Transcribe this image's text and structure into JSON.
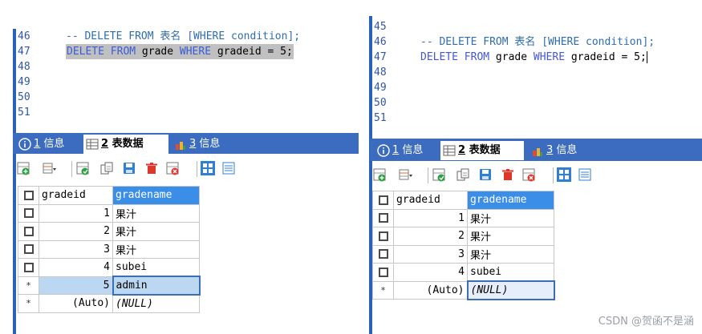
{
  "left": {
    "lines": [
      {
        "no": "46",
        "parts": [
          {
            "t": "-- DELETE FROM 表名 [WHERE condition];",
            "c": "cm"
          }
        ]
      },
      {
        "no": "47",
        "highlight": true,
        "parts": [
          {
            "t": "DELETE",
            "c": "kw"
          },
          {
            "t": " ",
            "c": "tx"
          },
          {
            "t": "FROM",
            "c": "kw"
          },
          {
            "t": " grade ",
            "c": "tx"
          },
          {
            "t": "WHERE",
            "c": "kw"
          },
          {
            "t": " gradeid = 5;",
            "c": "tx"
          }
        ]
      },
      {
        "no": "48",
        "parts": []
      },
      {
        "no": "49",
        "parts": []
      },
      {
        "no": "50",
        "parts": []
      },
      {
        "no": "51",
        "parts": []
      }
    ],
    "tabs": [
      {
        "num": "1",
        "label": "信息"
      },
      {
        "num": "2",
        "label": "表数据"
      },
      {
        "num": "3",
        "label": "信息"
      }
    ],
    "columns": [
      "gradeid",
      "gradename"
    ],
    "rows": [
      {
        "marker": "box",
        "id": "1",
        "name": "果汁"
      },
      {
        "marker": "box",
        "id": "2",
        "name": "果汁"
      },
      {
        "marker": "box",
        "id": "3",
        "name": "果汁"
      },
      {
        "marker": "box",
        "id": "4",
        "name": "subei"
      },
      {
        "marker": "*",
        "id": "5",
        "name": "admin",
        "selected": true
      },
      {
        "marker": "*",
        "id": "(Auto)",
        "name": "(NULL)"
      }
    ]
  },
  "right": {
    "lines": [
      {
        "no": "45",
        "parts": []
      },
      {
        "no": "46",
        "parts": [
          {
            "t": "-- DELETE FROM 表名 [WHERE condition];",
            "c": "cm"
          }
        ]
      },
      {
        "no": "47",
        "cursor": true,
        "parts": [
          {
            "t": "DELETE",
            "c": "kw2"
          },
          {
            "t": " ",
            "c": "tx"
          },
          {
            "t": "FROM",
            "c": "kw2"
          },
          {
            "t": " grade ",
            "c": "tx"
          },
          {
            "t": "WHERE",
            "c": "kw2"
          },
          {
            "t": " gradeid = 5;",
            "c": "tx"
          }
        ]
      },
      {
        "no": "48",
        "parts": []
      },
      {
        "no": "49",
        "parts": []
      },
      {
        "no": "50",
        "parts": []
      },
      {
        "no": "51",
        "parts": []
      }
    ],
    "tabs": [
      {
        "num": "1",
        "label": "信息"
      },
      {
        "num": "2",
        "label": "表数据"
      },
      {
        "num": "3",
        "label": "信息"
      }
    ],
    "columns": [
      "gradeid",
      "gradename"
    ],
    "rows": [
      {
        "marker": "box",
        "id": "1",
        "name": "果汁"
      },
      {
        "marker": "box",
        "id": "2",
        "name": "果汁"
      },
      {
        "marker": "box",
        "id": "3",
        "name": "果汁"
      },
      {
        "marker": "box",
        "id": "4",
        "name": "subei"
      },
      {
        "marker": "*",
        "id": "(Auto)",
        "name": "(NULL)",
        "focused": true
      }
    ]
  },
  "toolbar_icons": [
    "add-row-icon",
    "dropdown-grid-icon",
    "duplicate-row-icon",
    "copy-icon",
    "save-icon",
    "delete-icon",
    "cancel-icon",
    "grid-view-icon",
    "form-view-icon"
  ],
  "watermark": "CSDN @贺函不是涵",
  "colors": {
    "tab_bar": "#3c6cc0",
    "header_selected": "#3b8ee8",
    "keyword": "#3a5cd6",
    "comment": "#2e6db0",
    "line_number": "#2f56a8"
  }
}
